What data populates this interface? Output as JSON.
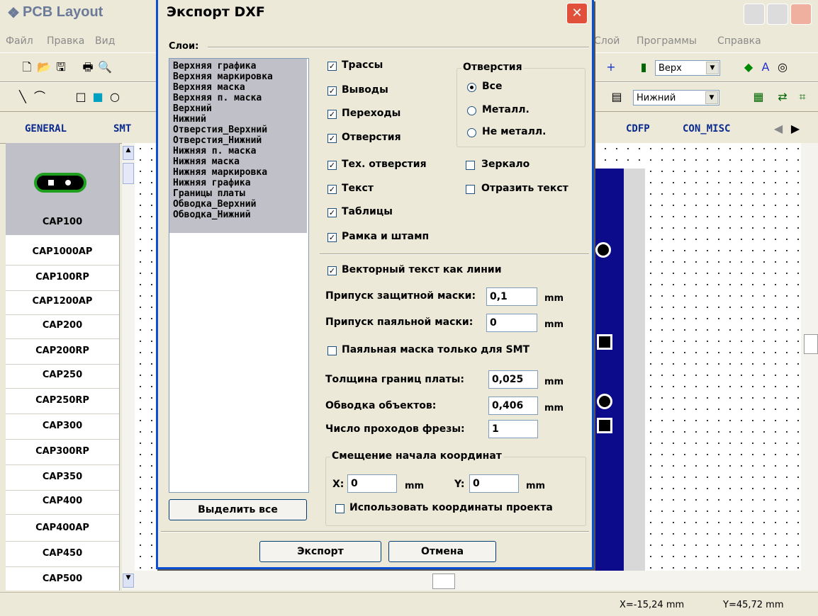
{
  "app": {
    "title": "PCB Layout"
  },
  "menu": {
    "items": [
      "Файл",
      "Правка",
      "Вид",
      "Слой",
      "Программы",
      "Справка"
    ]
  },
  "toolbar": {
    "top_layer": "Верх",
    "bottom_layer": "Нижний"
  },
  "tabs": [
    "GENERAL",
    "SMT",
    "CDFP",
    "CON_MISC"
  ],
  "components": [
    "CAP100",
    "CAP1000AP",
    "CAP100RP",
    "CAP1200AP",
    "CAP200",
    "CAP200RP",
    "CAP250",
    "CAP250RP",
    "CAP300",
    "CAP300RP",
    "CAP350",
    "CAP400",
    "CAP400AP",
    "CAP450",
    "CAP500"
  ],
  "status": {
    "x": "X=-15,24 mm",
    "y": "Y=45,72 mm"
  },
  "dialog": {
    "title": "Экспорт DXF",
    "layers_label": "Слои:",
    "layers": [
      "Верхняя графика",
      "Верхняя маркировка",
      "Верхняя маска",
      "Верхняя п. маска",
      "Верхний",
      "Нижний",
      "Отверстия_Верхний",
      "Отверстия_Нижний",
      "Нижняя п. маска",
      "Нижняя маска",
      "Нижняя маркировка",
      "Нижняя графика",
      "Границы платы",
      "Обводка_Верхний",
      "Обводка_Нижний"
    ],
    "select_all": "Выделить все",
    "checks": {
      "traces": "Трассы",
      "pins": "Выводы",
      "vias": "Переходы",
      "holes": "Отверстия",
      "tech_holes": "Тех. отверстия",
      "text": "Текст",
      "tables": "Таблицы",
      "frame": "Рамка и штамп",
      "mirror": "Зеркало",
      "mirror_text": "Отразить текст",
      "vector_text": "Векторный текст как линии",
      "smt_only": "Паяльная маска только для SMT",
      "use_project": "Использовать координаты проекта"
    },
    "holes_group": {
      "title": "Отверстия",
      "all": "Все",
      "metal": "Металл.",
      "nonmetal": "Не металл."
    },
    "fields": {
      "mask_clearance_label": "Припуск защитной маски:",
      "mask_clearance": "0,1",
      "paste_clearance_label": "Припуск паяльной маски:",
      "paste_clearance": "0",
      "board_width_label": "Толщина границ платы:",
      "board_width": "0,025",
      "outline_label": "Обводка объектов:",
      "outline": "0,406",
      "passes_label": "Число проходов фрезы:",
      "passes": "1"
    },
    "origin": {
      "title": "Смещение начала координат",
      "x_label": "X:",
      "x": "0",
      "y_label": "Y:",
      "y": "0"
    },
    "unit": "mm",
    "export": "Экспорт",
    "cancel": "Отмена"
  }
}
